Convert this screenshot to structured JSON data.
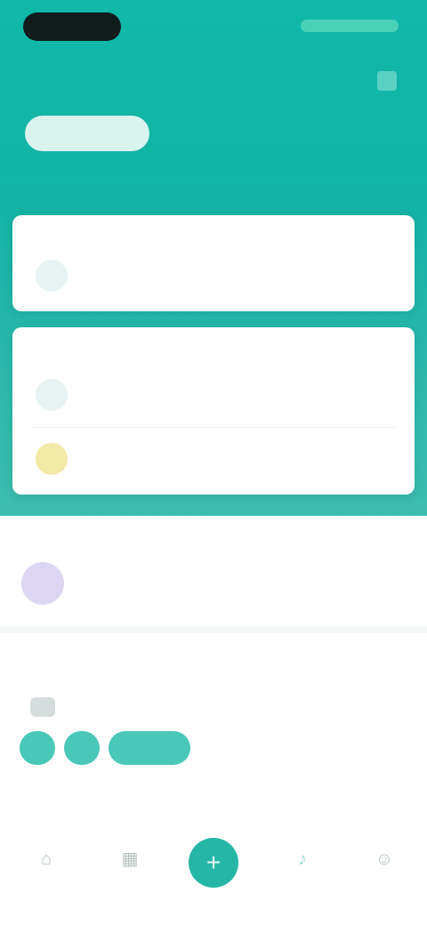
{
  "header": {
    "top_title": "",
    "tabs": [
      {
        "label": ""
      },
      {
        "label": ""
      },
      {
        "label": ""
      },
      {
        "label": ""
      }
    ],
    "subline": ""
  },
  "card1": {
    "title": "",
    "more": "",
    "rows": [
      {
        "text": ""
      }
    ]
  },
  "card2": {
    "title": "",
    "more": "",
    "rows": [
      {
        "text": ""
      },
      {
        "text": ""
      }
    ]
  },
  "section3": {
    "title": "",
    "more": "",
    "rows": [
      {
        "text": ""
      }
    ]
  },
  "section4": {
    "title": "",
    "more": "",
    "chips": [
      {
        "label": ""
      },
      {
        "label": ""
      },
      {
        "label": ""
      }
    ]
  },
  "section5": {
    "title": "",
    "more": ""
  },
  "bottom_nav": {
    "items": [
      {
        "label": "",
        "icon": "home-icon"
      },
      {
        "label": "",
        "icon": "grid-icon"
      },
      {
        "label": "",
        "icon": "add-icon"
      },
      {
        "label": "",
        "icon": "bell-icon"
      },
      {
        "label": "",
        "icon": "user-icon"
      }
    ]
  },
  "colors": {
    "header_teal": "#14b3a5",
    "accent": "#25b6a6",
    "status_pill": "#101c1c",
    "chip": "#49c7b8",
    "icon_yellow": "#f3e9a6",
    "icon_purple": "#dcd6f3"
  }
}
